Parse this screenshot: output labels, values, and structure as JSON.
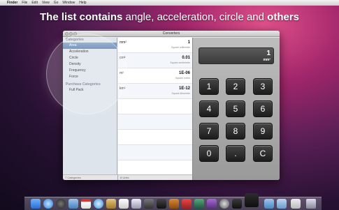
{
  "caption": {
    "part1": "The list contains",
    "part2": " angle, acceleration, circle and ",
    "part3": "others"
  },
  "menubar": {
    "apple": "",
    "app": "Finder",
    "items": [
      "File",
      "Edit",
      "View",
      "Go",
      "Window",
      "Help"
    ]
  },
  "window": {
    "title": "Converters"
  },
  "sidebar": {
    "header_categories": "Categories",
    "items": [
      "Area",
      "Acceleration",
      "Circle",
      "Density",
      "Frequency",
      "Force"
    ],
    "header_purchase": "Purchase Categories",
    "purchase_items": [
      "Full Pack"
    ],
    "footer": "7 Categories"
  },
  "units": {
    "rows": [
      {
        "symbol": "mm²",
        "value": "1",
        "name": "Square millimeter"
      },
      {
        "symbol": "cm²",
        "value": "0.01",
        "name": "Square centimeter"
      },
      {
        "symbol": "m²",
        "value": "1E-06",
        "name": "Square meter"
      },
      {
        "symbol": "km²",
        "value": "1E-12",
        "name": "Square kilometer"
      }
    ],
    "footer": "8 Units"
  },
  "calculator": {
    "display_value": "1",
    "display_unit": "mm²",
    "keys": [
      "1",
      "2",
      "3",
      "4",
      "5",
      "6",
      "7",
      "8",
      "9",
      "0",
      ".",
      "C"
    ]
  },
  "dock": {
    "icons": [
      "finder-icon",
      "safari-icon",
      "dashboard-icon",
      "mail-icon",
      "ical-icon",
      "itunes-icon",
      "iphoto-icon",
      "app-store-icon",
      "preview-icon",
      "system-preferences-icon",
      "terminal-icon",
      "folder-icon",
      "trash-icon"
    ]
  }
}
